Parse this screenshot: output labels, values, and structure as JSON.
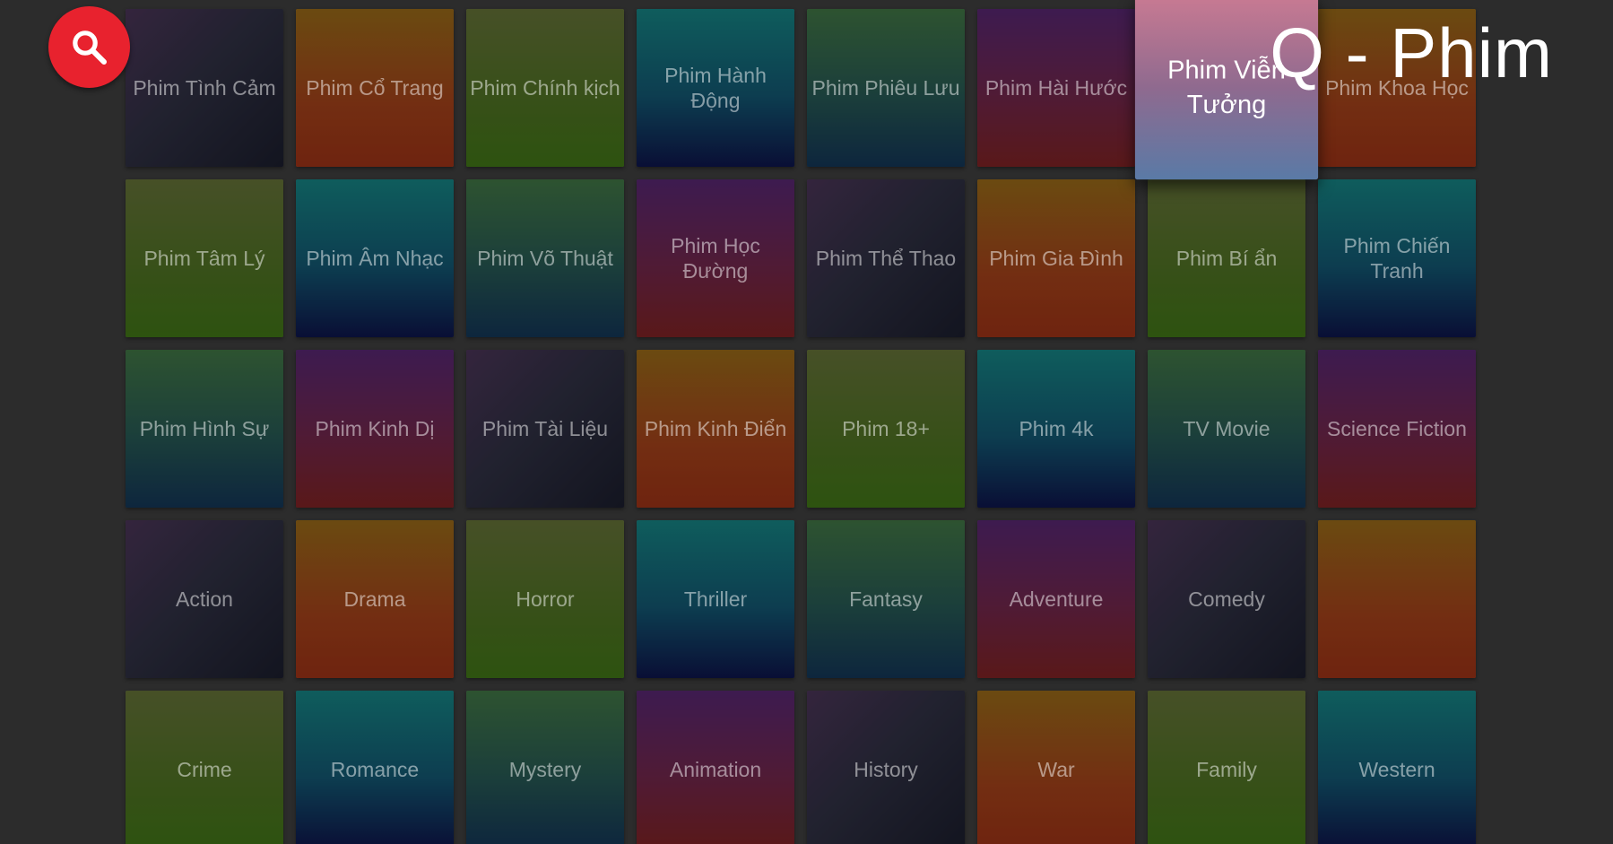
{
  "app_title": "Q - Phim",
  "search": {
    "icon": "search-icon",
    "color": "#e8222e"
  },
  "focused_index": 6,
  "categories": [
    {
      "label": "Phim Tình Cảm",
      "style": "slate"
    },
    {
      "label": "Phim Cổ Trang",
      "style": "orange"
    },
    {
      "label": "Phim Chính kịch",
      "style": "olive"
    },
    {
      "label": "Phim Hành Động",
      "style": "teal"
    },
    {
      "label": "Phim Phiêu Lưu",
      "style": "forest"
    },
    {
      "label": "Phim Hài Hước",
      "style": "purple"
    },
    {
      "label": "Phim Viễn Tưởng",
      "style": "pink"
    },
    {
      "label": "Phim Khoa Học",
      "style": "orange"
    },
    {
      "label": "Phim Tâm Lý",
      "style": "olive"
    },
    {
      "label": "Phim Âm Nhạc",
      "style": "teal"
    },
    {
      "label": "Phim Võ Thuật",
      "style": "forest"
    },
    {
      "label": "Phim Học Đường",
      "style": "purple"
    },
    {
      "label": "Phim Thể Thao",
      "style": "slate"
    },
    {
      "label": "Phim Gia Đình",
      "style": "orange"
    },
    {
      "label": "Phim Bí ẩn",
      "style": "olive"
    },
    {
      "label": "Phim Chiến Tranh",
      "style": "teal"
    },
    {
      "label": "Phim Hình Sự",
      "style": "forest"
    },
    {
      "label": "Phim Kinh Dị",
      "style": "purple"
    },
    {
      "label": "Phim Tài Liệu",
      "style": "slate"
    },
    {
      "label": "Phim Kinh Điển",
      "style": "orange"
    },
    {
      "label": "Phim 18+",
      "style": "olive"
    },
    {
      "label": "Phim 4k",
      "style": "teal"
    },
    {
      "label": "TV Movie",
      "style": "forest"
    },
    {
      "label": "Science Fiction",
      "style": "purple"
    },
    {
      "label": "Action",
      "style": "slate"
    },
    {
      "label": "Drama",
      "style": "orange"
    },
    {
      "label": "Horror",
      "style": "olive"
    },
    {
      "label": "Thriller",
      "style": "teal"
    },
    {
      "label": "Fantasy",
      "style": "forest"
    },
    {
      "label": "Adventure",
      "style": "purple"
    },
    {
      "label": "Comedy",
      "style": "slate"
    },
    {
      "label": "",
      "style": "orange"
    },
    {
      "label": "Crime",
      "style": "olive"
    },
    {
      "label": "Romance",
      "style": "teal"
    },
    {
      "label": "Mystery",
      "style": "forest"
    },
    {
      "label": "Animation",
      "style": "purple"
    },
    {
      "label": "History",
      "style": "slate"
    },
    {
      "label": "War",
      "style": "orange"
    },
    {
      "label": "Family",
      "style": "olive"
    },
    {
      "label": "Western",
      "style": "teal"
    }
  ]
}
